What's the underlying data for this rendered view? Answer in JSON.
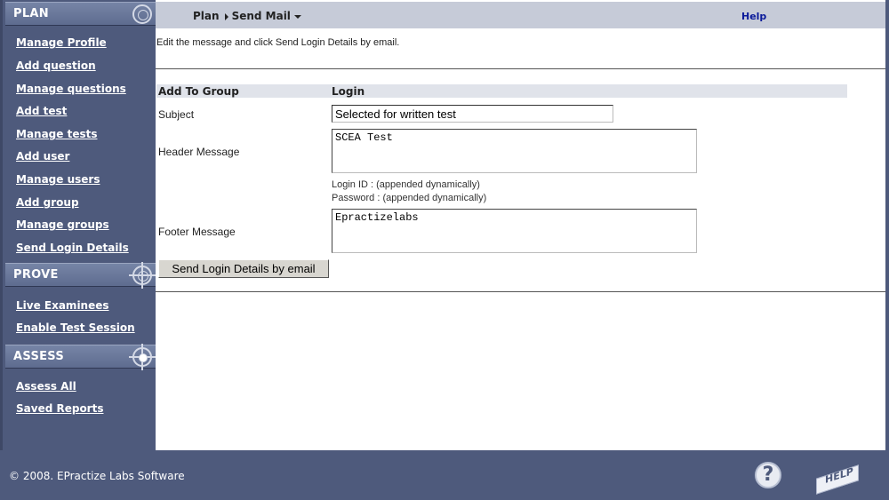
{
  "sidebar": {
    "plan": {
      "title": "PLAN",
      "items": [
        "Manage Profile",
        "Add question",
        "Manage questions",
        "Add test",
        "Manage tests",
        "Add user",
        "Manage users",
        "Add group",
        "Manage groups",
        "Send Login Details"
      ]
    },
    "prove": {
      "title": "PROVE",
      "items": [
        "Live Examinees",
        "Enable Test Session"
      ]
    },
    "assess": {
      "title": "ASSESS",
      "items": [
        "Assess All",
        "Saved Reports"
      ]
    }
  },
  "topbar": {
    "crumb_plan": "Plan",
    "crumb_current": "Send Mail",
    "help": "Help"
  },
  "form": {
    "instruction": "Edit the message and click Send Login Details by email.",
    "col1": "Add To Group",
    "col2": "Login",
    "subject_label": "Subject",
    "subject_value": "Selected for written test",
    "header_label": "Header Message",
    "header_value": "SCEA Test",
    "login_note": "Login ID : (appended dynamically)",
    "password_note": "Password : (appended dynamically)",
    "footer_label": "Footer Message",
    "footer_value": "Epractizelabs",
    "send_button": "Send Login Details by email"
  },
  "footer": {
    "copyright": "© 2008. EPractize Labs Software",
    "help_icon_text": "HELP"
  },
  "icons": {
    "plan": "circle-icon",
    "prove": "crosshair-icon",
    "assess": "target-icon",
    "question": "question-icon",
    "help": "help-sign-icon"
  }
}
